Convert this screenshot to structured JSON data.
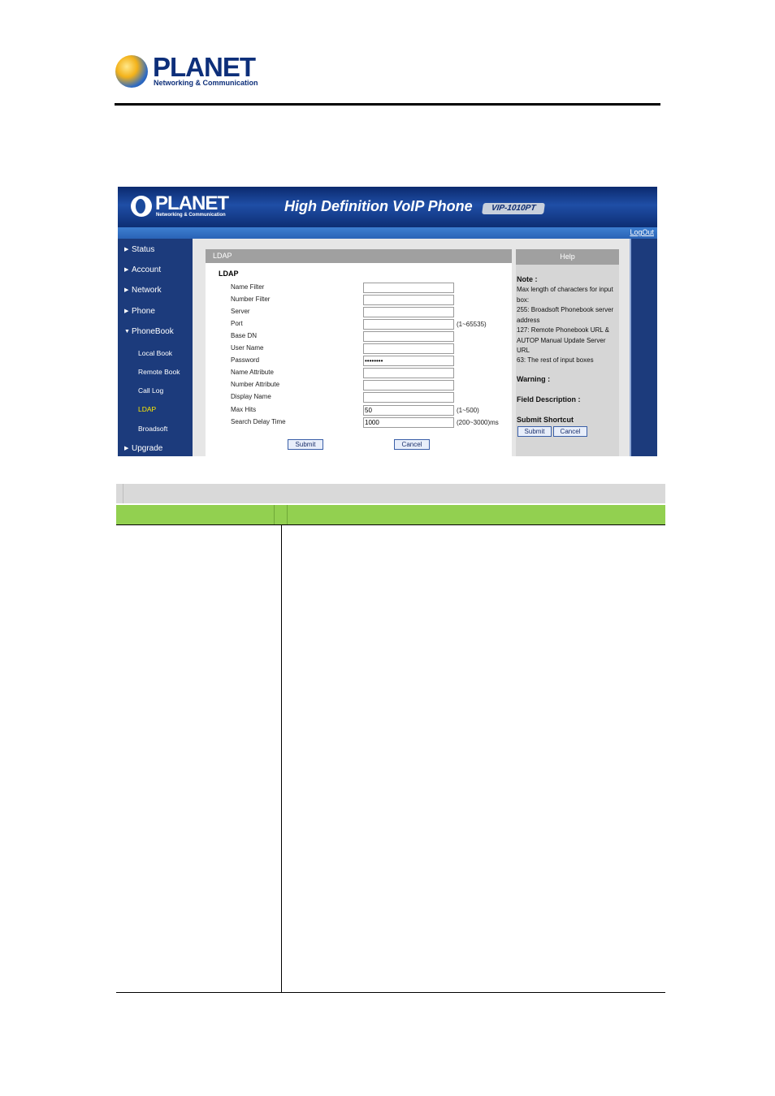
{
  "doc_logo": {
    "word": "PLANET",
    "subtitle": "Networking & Communication"
  },
  "banner": {
    "logo_word": "PLANET",
    "logo_sub": "Networking & Communication",
    "title": "High Definition VoIP Phone",
    "model": "VIP-1010PT",
    "logout": "LogOut"
  },
  "sidebar": {
    "items": [
      {
        "label": "Status"
      },
      {
        "label": "Account"
      },
      {
        "label": "Network"
      },
      {
        "label": "Phone"
      },
      {
        "label": "PhoneBook"
      }
    ],
    "subitems": [
      {
        "label": "Local Book"
      },
      {
        "label": "Remote Book"
      },
      {
        "label": "Call Log"
      },
      {
        "label": "LDAP"
      },
      {
        "label": "Broadsoft"
      }
    ],
    "upgrade": "Upgrade"
  },
  "panel": {
    "header": "LDAP",
    "subtitle": "LDAP",
    "fields": [
      {
        "label": "Name Filter",
        "value": "",
        "hint": ""
      },
      {
        "label": "Number Filter",
        "value": "",
        "hint": ""
      },
      {
        "label": "Server",
        "value": "",
        "hint": ""
      },
      {
        "label": "Port",
        "value": "",
        "hint": "(1~65535)"
      },
      {
        "label": "Base DN",
        "value": "",
        "hint": ""
      },
      {
        "label": "User Name",
        "value": "",
        "hint": ""
      },
      {
        "label": "Password",
        "value": "••••••••",
        "hint": ""
      },
      {
        "label": "Name Attribute",
        "value": "",
        "hint": ""
      },
      {
        "label": "Number Attribute",
        "value": "",
        "hint": ""
      },
      {
        "label": "Display Name",
        "value": "",
        "hint": ""
      },
      {
        "label": "Max Hits",
        "value": "50",
        "hint": "(1~500)"
      },
      {
        "label": "Search Delay Time",
        "value": "1000",
        "hint": "(200~3000)ms"
      }
    ],
    "submit": "Submit",
    "cancel": "Cancel"
  },
  "help": {
    "header": "Help",
    "note_title": "Note :",
    "note_lines": [
      "Max length of characters for input box:",
      "255: Broadsoft Phonebook server address",
      "127: Remote Phonebook URL & AUTOP Manual Update Server URL",
      "63: The rest of input boxes"
    ],
    "warning": "Warning :",
    "field_description": "Field Description :",
    "submit_shortcut": "Submit Shortcut",
    "submit": "Submit",
    "cancel": "Cancel"
  },
  "colors": {
    "sidebar": "#1c3b7c",
    "active_menu": "#ffea00",
    "table_header": "#92d050"
  }
}
